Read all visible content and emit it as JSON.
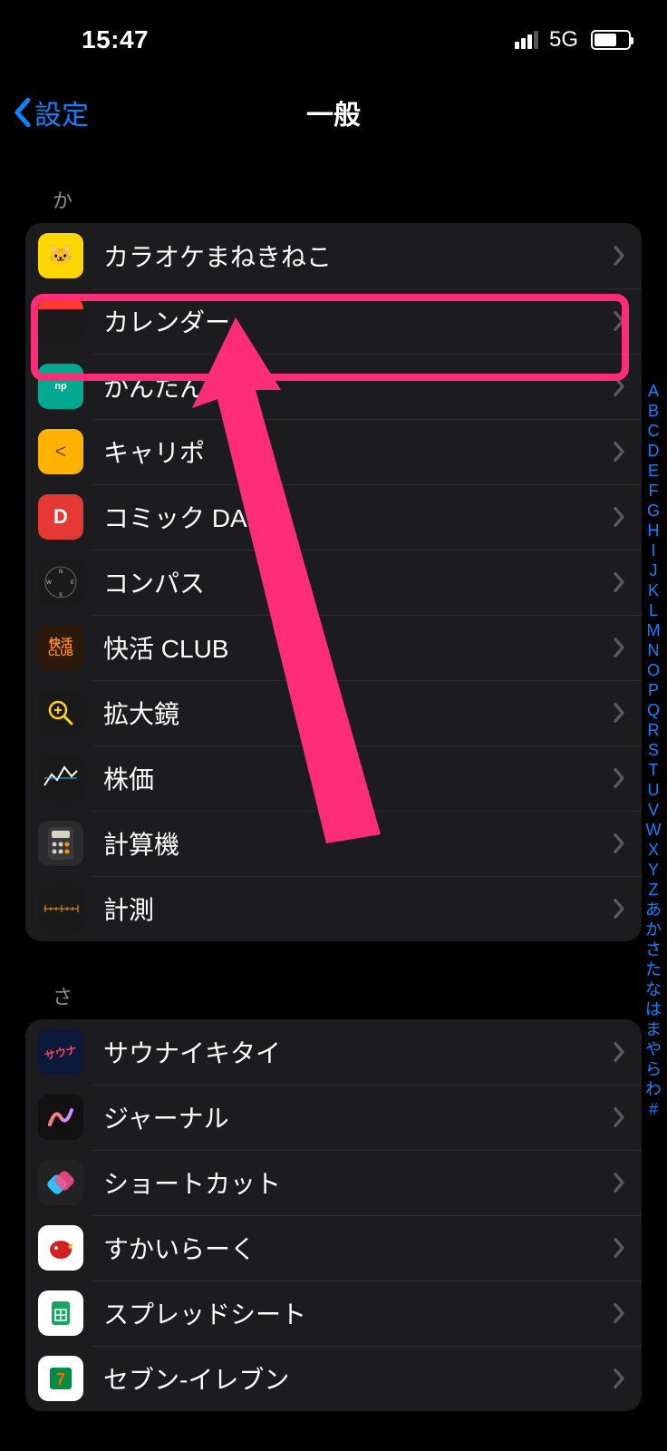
{
  "status": {
    "time": "15:47",
    "network": "5G"
  },
  "nav": {
    "back": "設定",
    "title": "一般"
  },
  "sections": [
    {
      "header": "か",
      "rows": [
        {
          "label": "カラオケまねきねこ",
          "icon": "maneki"
        },
        {
          "label": "カレンダー",
          "icon": "calendar",
          "highlighted": true
        },
        {
          "label": "かんたん        rint",
          "icon": "netprint"
        },
        {
          "label": "キャリポ",
          "icon": "kyaripo"
        },
        {
          "label": "コミック DAYS",
          "icon": "comicdays"
        },
        {
          "label": "コンパス",
          "icon": "compass"
        },
        {
          "label": "快活 CLUB",
          "icon": "kaikatsu"
        },
        {
          "label": "拡大鏡",
          "icon": "magnifier"
        },
        {
          "label": "株価",
          "icon": "stocks"
        },
        {
          "label": "計算機",
          "icon": "calculator"
        },
        {
          "label": "計測",
          "icon": "measure"
        }
      ]
    },
    {
      "header": "さ",
      "rows": [
        {
          "label": "サウナイキタイ",
          "icon": "sauna"
        },
        {
          "label": "ジャーナル",
          "icon": "journal"
        },
        {
          "label": "ショートカット",
          "icon": "shortcuts"
        },
        {
          "label": "すかいらーく",
          "icon": "skylark"
        },
        {
          "label": "スプレッドシート",
          "icon": "sheets"
        },
        {
          "label": "セブン-イレブン",
          "icon": "seven"
        }
      ]
    }
  ],
  "index": [
    "A",
    "B",
    "C",
    "D",
    "E",
    "F",
    "G",
    "H",
    "I",
    "J",
    "K",
    "L",
    "M",
    "N",
    "O",
    "P",
    "Q",
    "R",
    "S",
    "T",
    "U",
    "V",
    "W",
    "X",
    "Y",
    "Z",
    "あ",
    "か",
    "さ",
    "た",
    "な",
    "は",
    "ま",
    "や",
    "ら",
    "わ",
    "#"
  ]
}
